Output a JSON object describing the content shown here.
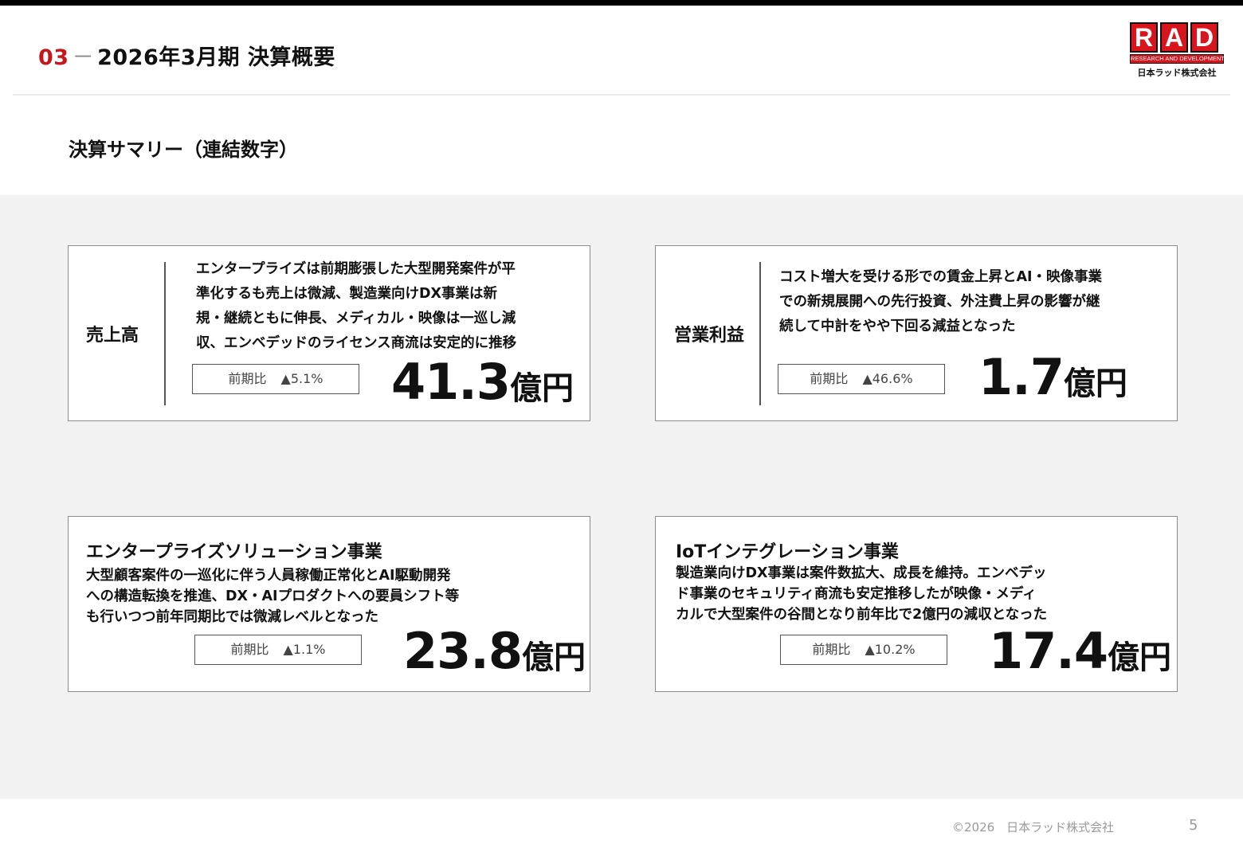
{
  "header": {
    "section_number": "03",
    "section_dash": "－",
    "title": "2026年3月期 決算概要"
  },
  "logo": {
    "letters": [
      "R",
      "A",
      "D"
    ],
    "tagline": "RESEARCH AND DEVELOPMENT",
    "company": "日本ラッド株式会社"
  },
  "section_title": "決算サマリー（連結数字）",
  "cards": {
    "sales": {
      "label": "売上高",
      "lines": [
        "エンタープライズは前期膨張した大型開発案件が平",
        "準化するも売上は微減、製造業向けDX事業は新",
        "規・継続ともに伸長、メディカル・映像は一巡し減",
        "収、エンベデッドのライセンス商流は安定的に推移"
      ],
      "yoy_label": "前期比",
      "yoy_value": "▲5.1%",
      "value": "41.3",
      "unit": "億円"
    },
    "operating_profit": {
      "label": "営業利益",
      "lines": [
        "コスト増大を受ける形での賃金上昇とAI・映像事業",
        "での新規展開への先行投資、外注費上昇の影響が継",
        "続して中計をやや下回る減益となった"
      ],
      "yoy_label": "前期比",
      "yoy_value": "▲46.6%",
      "value": "1.7",
      "unit": "億円"
    },
    "enterprise": {
      "title": "エンタープライズソリューション事業",
      "lines": [
        "大型顧客案件の一巡化に伴う人員稼働正常化とAI駆動開発",
        "への構造転換を推進、DX・AIプロダクトへの要員シフト等",
        "も行いつつ前年同期比では微減レベルとなった"
      ],
      "yoy_label": "前期比",
      "yoy_value": "▲1.1%",
      "value": "23.8",
      "unit": "億円"
    },
    "iot": {
      "title": "IoTインテグレーション事業",
      "lines": [
        "製造業向けDX事業は案件数拡大、成長を維持。エンベデッ",
        "ド事業のセキュリティ商流も安定推移したが映像・メディ",
        "カルで大型案件の谷間となり前年比で2億円の減収となった"
      ],
      "yoy_label": "前期比",
      "yoy_value": "▲10.2%",
      "value": "17.4",
      "unit": "億円"
    }
  },
  "footer": {
    "copyright": "©2026　日本ラッド株式会社",
    "page": "5"
  }
}
